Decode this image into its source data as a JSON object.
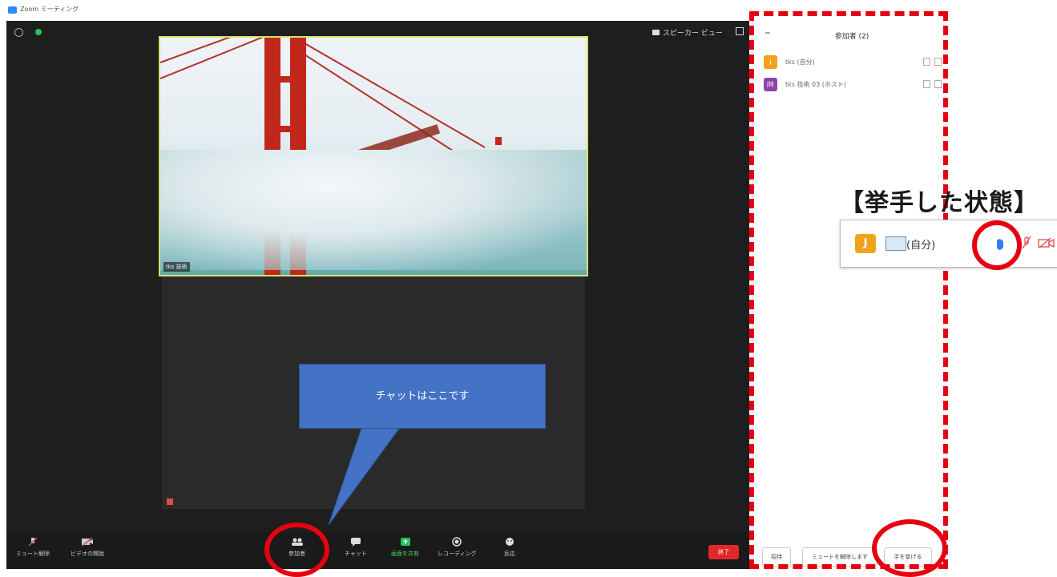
{
  "window": {
    "title": "Zoom ミーティング"
  },
  "meeting": {
    "view_button_label": "スピーカー ビュー",
    "main_video_label": "tks 技術",
    "callout_text": "チャットはここです"
  },
  "toolbar": {
    "mute_label": "ミュート解除",
    "video_label": "ビデオの開始",
    "participants_label": "参加者",
    "participants_count": "2",
    "chat_label": "チャット",
    "share_label": "画面を共有",
    "record_label": "レコーディング",
    "reactions_label": "反応",
    "end_label": "終了"
  },
  "panel": {
    "title": "参加者 (2)",
    "participants": [
      {
        "initial": "J",
        "name": "tks (自分)",
        "color": "#f0a31a"
      },
      {
        "initial": "J技",
        "name": "tks 技術 03 (ホスト)",
        "color": "#8e44ad"
      }
    ],
    "invite_label": "招待",
    "unmute_label": "ミュートを解除します",
    "raise_hand_label": "手を挙げる"
  },
  "annotation": {
    "title": "【挙手した状態】",
    "participant_initial": "J",
    "participant_label": "(自分)",
    "highlight_color": "#e60012"
  }
}
